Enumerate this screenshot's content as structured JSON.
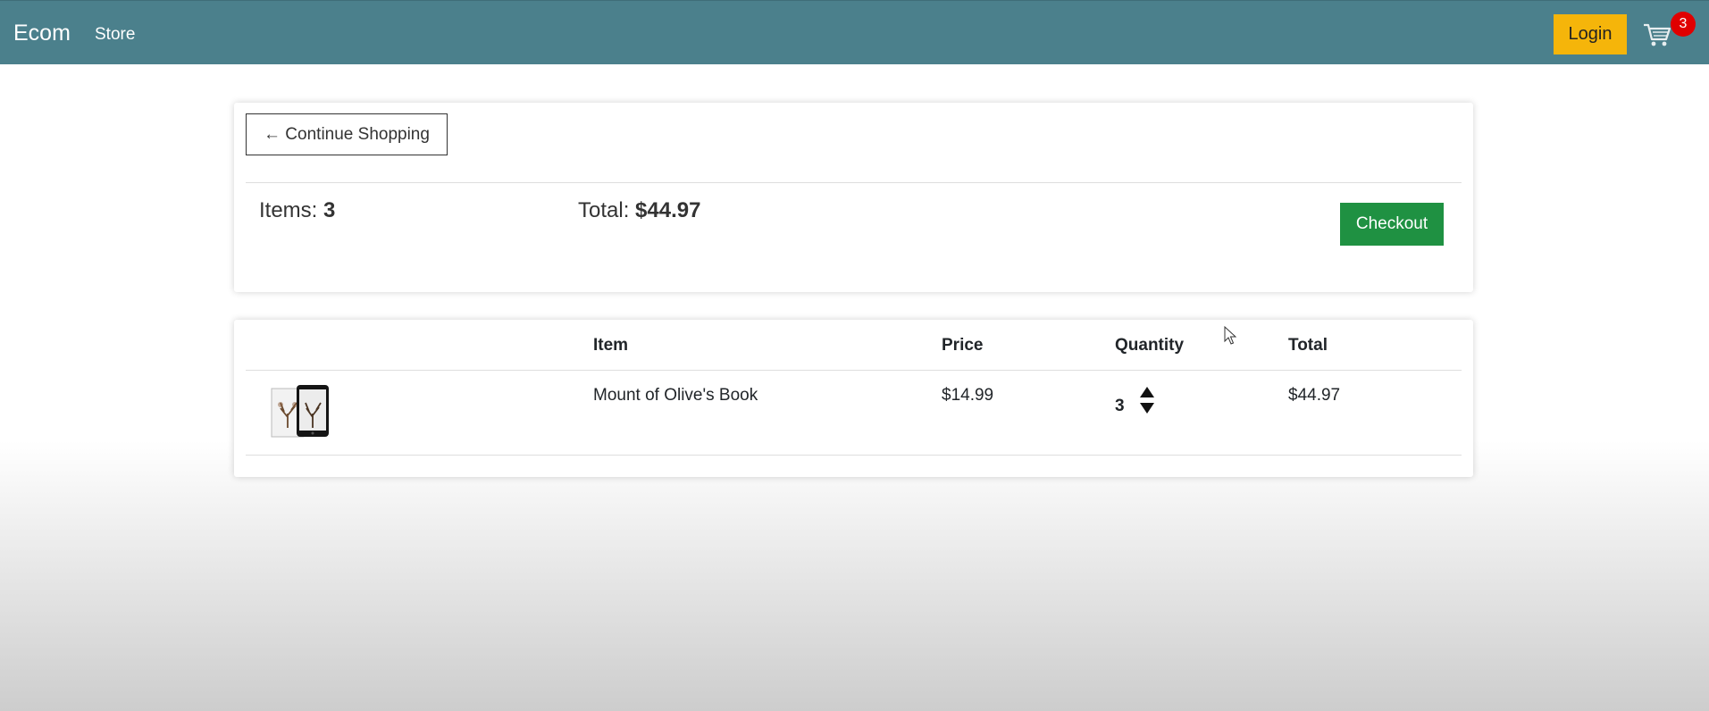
{
  "navbar": {
    "brand": "Ecom",
    "links": [
      "Store"
    ],
    "login_label": "Login",
    "cart_icon": "cart-icon",
    "cart_count": "3",
    "background": "#4b808c"
  },
  "summary": {
    "continue_label": "← Continue Shopping",
    "items_label": "Items:",
    "items_value": "3",
    "total_label": "Total:",
    "total_value": "$44.97",
    "checkout_label": "Checkout"
  },
  "cart": {
    "headers": [
      "Item",
      "Price",
      "Quantity",
      "Total"
    ],
    "rows": [
      {
        "image_icon": "book-thumbnail",
        "item": "Mount of Olive's Book",
        "price": "$14.99",
        "quantity": "3",
        "total": "$44.97"
      }
    ]
  },
  "colors": {
    "checkout": "#1f9142",
    "login": "#f5b50a",
    "badge": "#e00000"
  }
}
